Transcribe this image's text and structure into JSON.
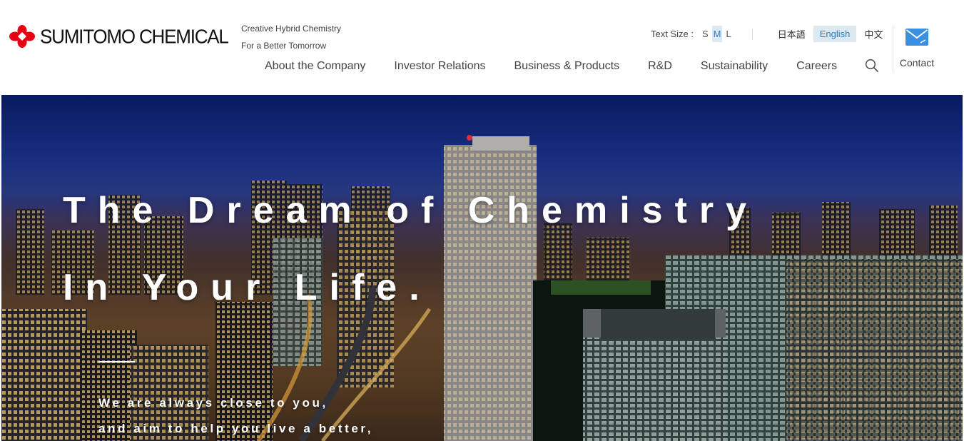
{
  "brand": {
    "name": "SUMITOMO CHEMICAL",
    "tagline_line1": "Creative Hybrid Chemistry",
    "tagline_line2": "For a Better Tomorrow",
    "logo_color": "#e60012"
  },
  "utility": {
    "text_size_label": "Text Size :",
    "sizes": [
      "S",
      "M",
      "L"
    ],
    "selected_size": "M",
    "languages": [
      "日本語",
      "English",
      "中文"
    ],
    "selected_language": "English"
  },
  "nav": {
    "items": [
      "About the Company",
      "Investor Relations",
      "Business & Products",
      "R&D",
      "Sustainability",
      "Careers"
    ],
    "search_icon": "search-icon",
    "contact_label": "Contact",
    "contact_icon": "mail-icon"
  },
  "hero": {
    "title_line1": "The Dream of Chemistry",
    "title_line2": "In Your Life.",
    "sub_line1": "We are always close to you,",
    "sub_line2": "and aim to help you live a better,"
  },
  "colors": {
    "accent": "#2b7bc0",
    "selected_bg": "#dde9f1",
    "mail_icon": "#3b8fe0"
  }
}
